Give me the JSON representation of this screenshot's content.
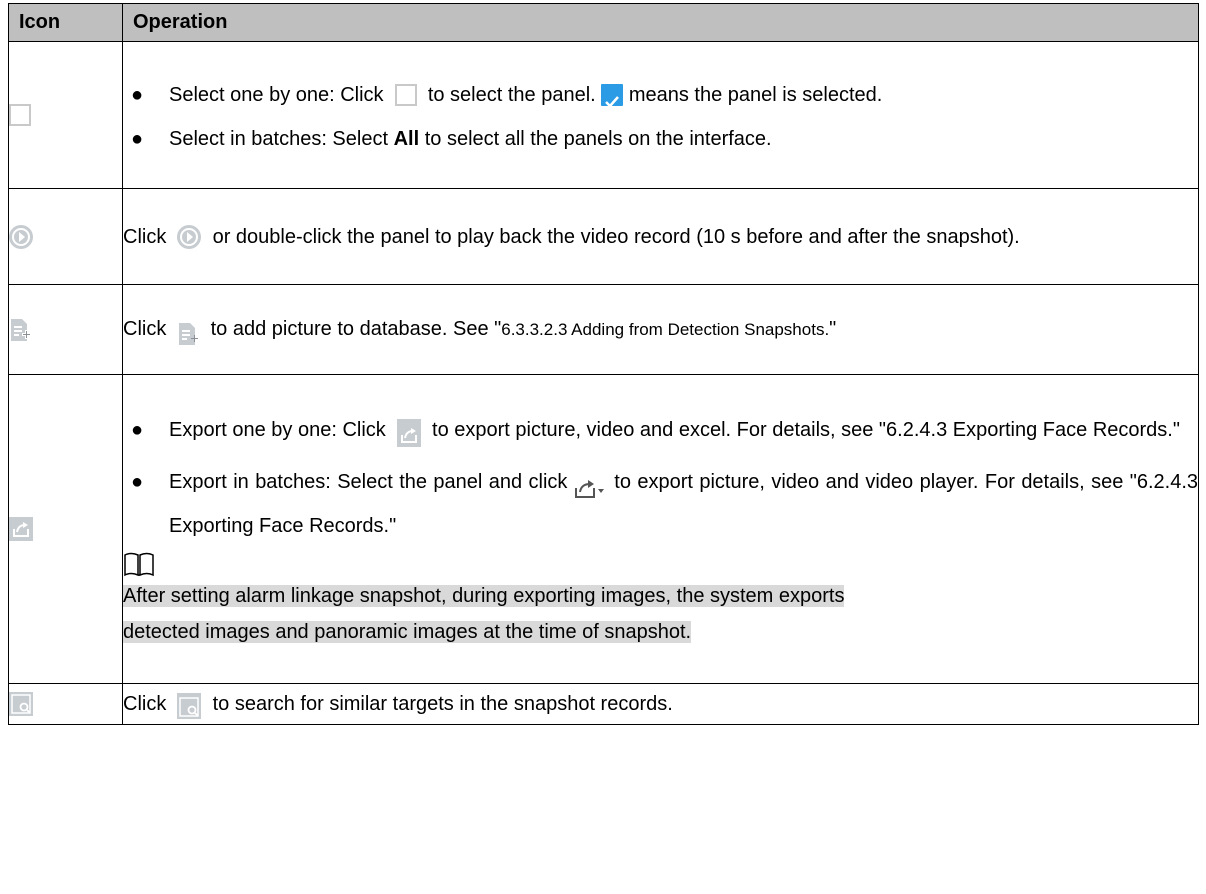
{
  "header": {
    "icon": "Icon",
    "operation": "Operation"
  },
  "rows": [
    {
      "icon_name": "checkbox-icon",
      "b1_a": "Select one by one: Click",
      "b1_b": "to select the panel.",
      "b1_c": "means the panel is selected.",
      "b2_a": "Select in batches: Select",
      "b2_bold": "All",
      "b2_b": "to select all the panels on the interface."
    },
    {
      "icon_name": "play-icon",
      "t_a": "Click",
      "t_b": "or double-click the panel to play back the video record (10 s before and after the snapshot)."
    },
    {
      "icon_name": "add-to-database-icon",
      "t_a": "Click",
      "t_b": "to add picture to database. See \"",
      "t_ref": "6.3.3.2.3 Adding from Detection Snapshots.",
      "t_c": "\""
    },
    {
      "icon_name": "export-icon",
      "b1_a": "Export one by one: Click",
      "b1_b": "to export picture, video and excel. For details, see \"6.2.4.3 Exporting Face Records.\"",
      "b2_a": "Export in batches: Select the panel and click",
      "b2_b": "to export picture, video and video player. For details, see \"6.2.4.3 Exporting Face Records.\"",
      "note_line1": "After setting alarm linkage snapshot, during exporting images, the system exports",
      "note_line2": "detected images and panoramic images at the time of snapshot."
    },
    {
      "icon_name": "search-similar-icon",
      "t_a": "Click",
      "t_b": "to search for similar targets in the snapshot records."
    }
  ],
  "colors": {
    "header_bg": "#bfbfbf",
    "icon_gray": "#c7ccd1",
    "checked_blue": "#2a9be4",
    "note_highlight": "#d9d9d9"
  }
}
